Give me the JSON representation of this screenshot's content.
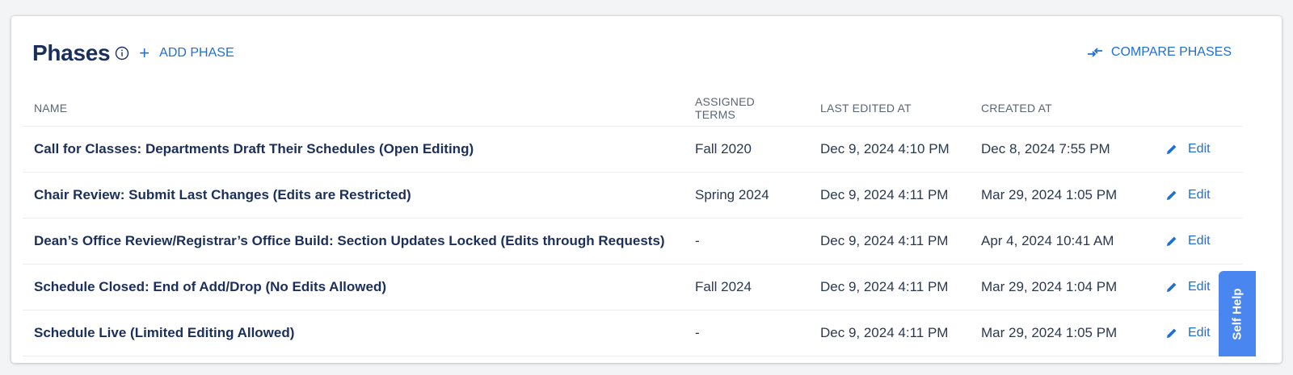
{
  "header": {
    "title": "Phases",
    "add_phase_label": "ADD PHASE",
    "compare_label": "COMPARE PHASES"
  },
  "table": {
    "columns": [
      "NAME",
      "ASSIGNED TERMS",
      "LAST EDITED AT",
      "CREATED AT"
    ],
    "rows": [
      {
        "name": "Call for Classes: Departments Draft Their Schedules (Open Editing)",
        "terms": "Fall 2020",
        "last_edited": "Dec 9, 2024 4:10 PM",
        "created": "Dec 8, 2024 7:55 PM",
        "edit": "Edit"
      },
      {
        "name": "Chair Review: Submit Last Changes (Edits are Restricted)",
        "terms": "Spring 2024",
        "last_edited": "Dec 9, 2024 4:11 PM",
        "created": "Mar 29, 2024 1:05 PM",
        "edit": "Edit"
      },
      {
        "name": "Dean’s Office Review/Registrar’s Office Build: Section Updates Locked (Edits through Requests)",
        "terms": "-",
        "last_edited": "Dec 9, 2024 4:11 PM",
        "created": "Apr 4, 2024 10:41 AM",
        "edit": "Edit"
      },
      {
        "name": "Schedule Closed: End of Add/Drop (No Edits Allowed)",
        "terms": "Fall 2024",
        "last_edited": "Dec 9, 2024 4:11 PM",
        "created": "Mar 29, 2024 1:04 PM",
        "edit": "Edit"
      },
      {
        "name": "Schedule Live (Limited Editing Allowed)",
        "terms": "-",
        "last_edited": "Dec 9, 2024 4:11 PM",
        "created": "Mar 29, 2024 1:05 PM",
        "edit": "Edit"
      }
    ]
  },
  "self_help": {
    "label": "Self Help"
  },
  "icons": {
    "info": "info-icon",
    "add": "plus-icon",
    "compare": "compare-arrows-icon",
    "edit": "pencil-icon"
  },
  "colors": {
    "title": "#1b2f5c",
    "link": "#1f6fd6",
    "self_help_bg": "#4a86f0"
  }
}
